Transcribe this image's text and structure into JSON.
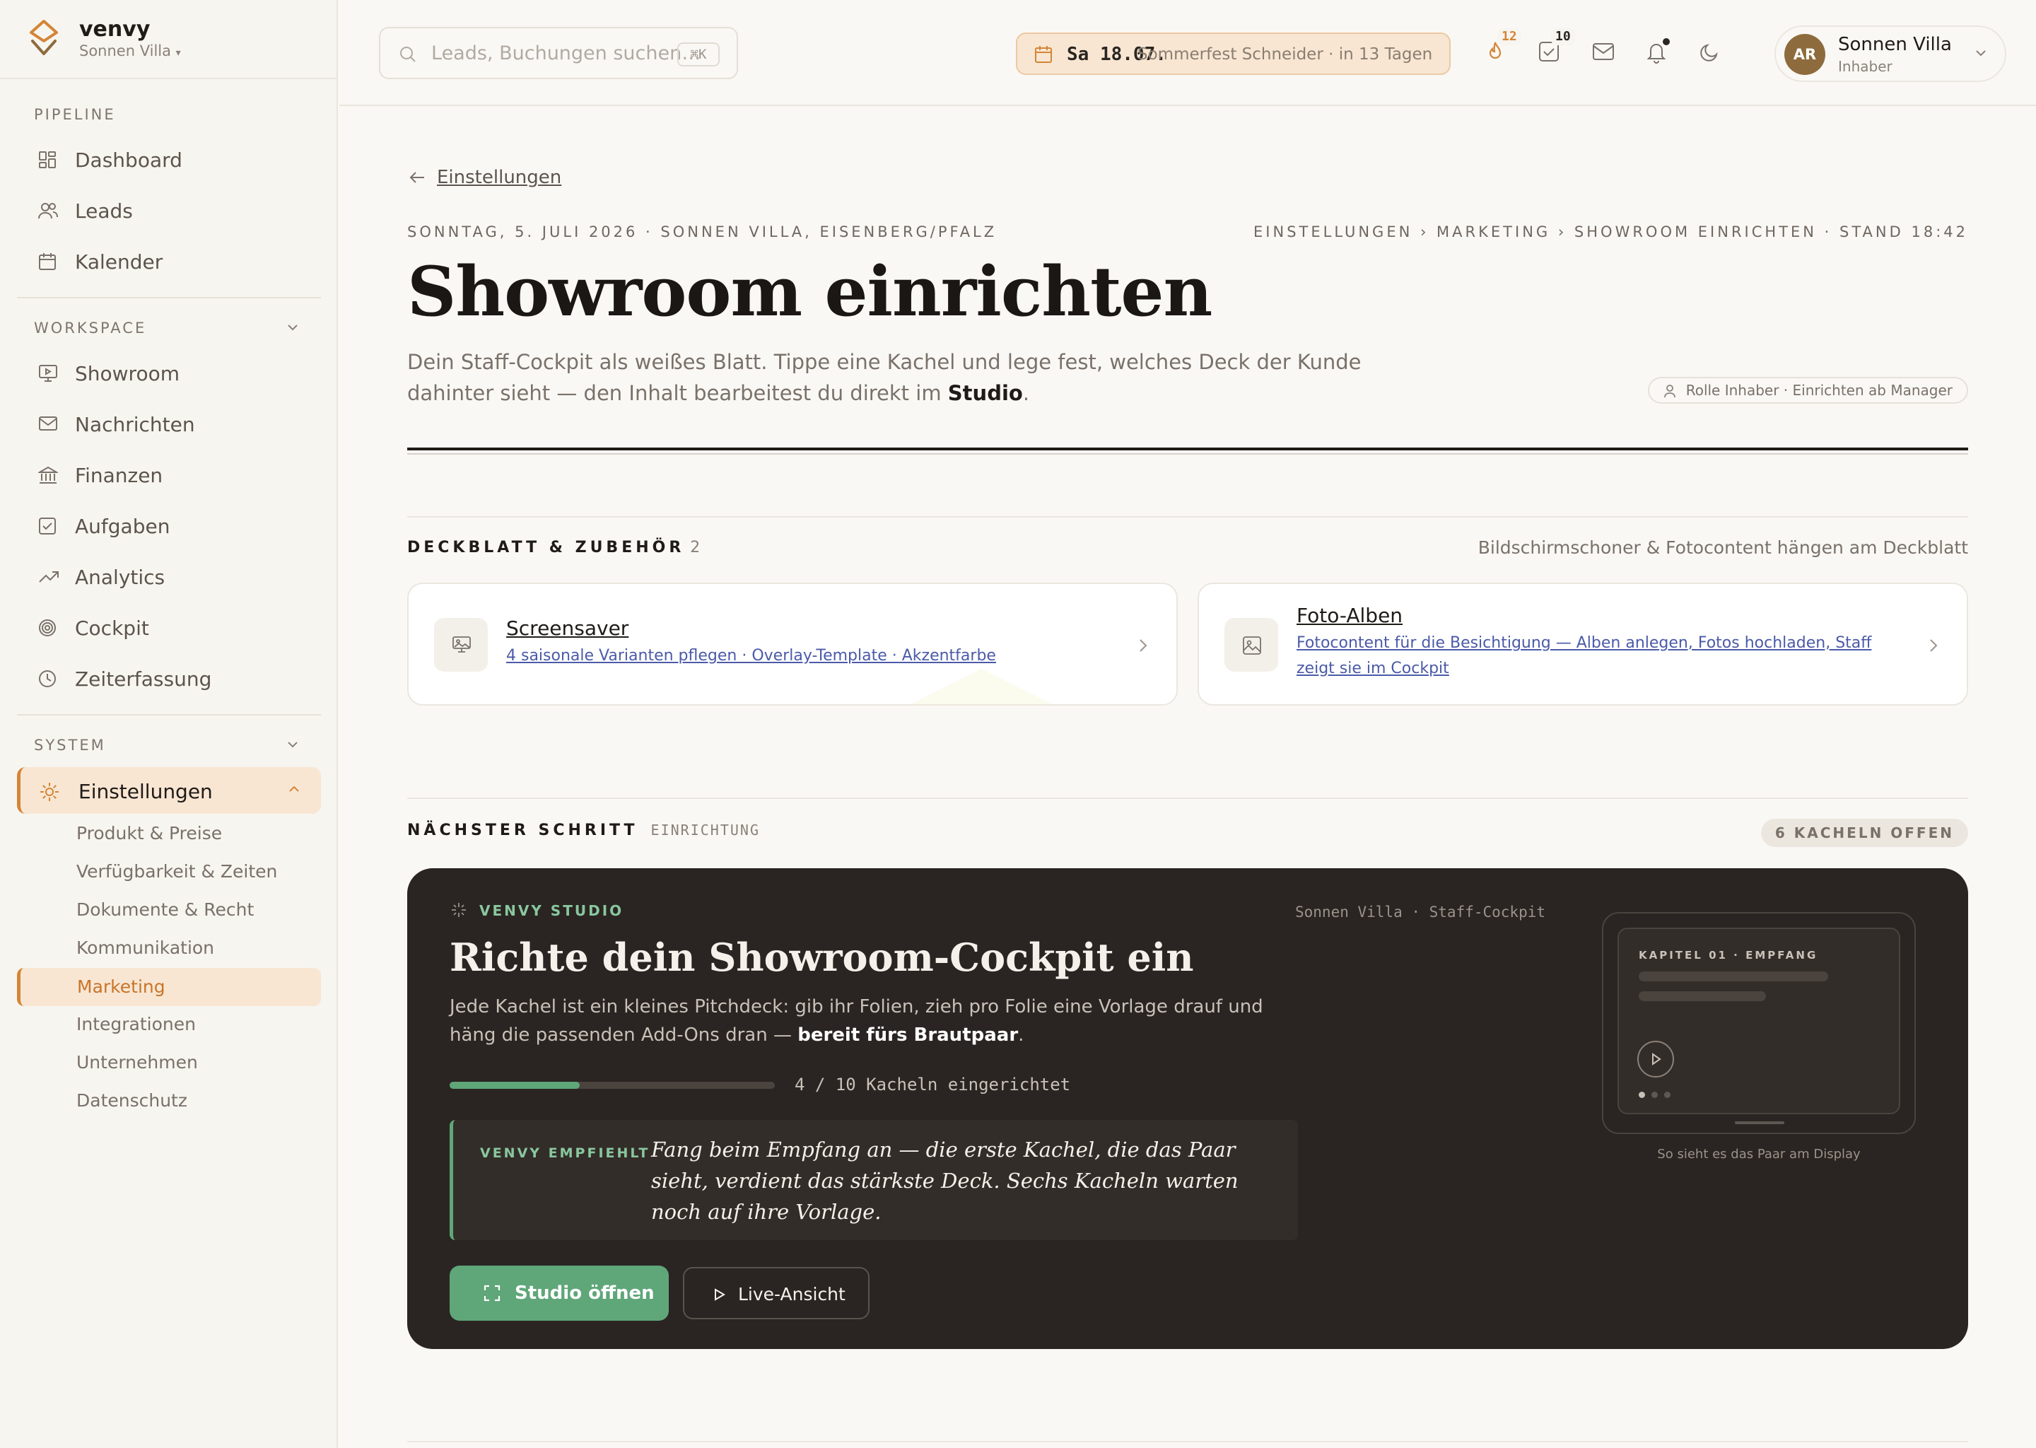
{
  "brand": {
    "name": "venvy",
    "venue": "Sonnen Villa",
    "venue_caret": "▾"
  },
  "sidebar": {
    "pipeline_title": "PIPELINE",
    "pipeline": [
      {
        "label": "Dashboard",
        "icon": "dashboard-icon"
      },
      {
        "label": "Leads",
        "icon": "users-icon"
      },
      {
        "label": "Kalender",
        "icon": "calendar-icon"
      }
    ],
    "workspace_title": "WORKSPACE",
    "workspace": [
      {
        "label": "Showroom",
        "icon": "presentation-icon"
      },
      {
        "label": "Nachrichten",
        "icon": "mail-icon"
      },
      {
        "label": "Finanzen",
        "icon": "bank-icon"
      },
      {
        "label": "Aufgaben",
        "icon": "checkbox-icon"
      },
      {
        "label": "Analytics",
        "icon": "trend-icon"
      },
      {
        "label": "Cockpit",
        "icon": "target-icon"
      },
      {
        "label": "Zeiterfassung",
        "icon": "clock-icon"
      }
    ],
    "system_title": "SYSTEM",
    "settings_label": "Einstellungen",
    "settings_sub": [
      "Produkt & Preise",
      "Verfügbarkeit & Zeiten",
      "Dokumente & Recht",
      "Kommunikation",
      "Marketing",
      "Integrationen",
      "Unternehmen",
      "Datenschutz"
    ]
  },
  "topbar": {
    "search_placeholder": "Leads, Buchungen suchen…",
    "search_kbd": "⌘K",
    "date": "Sa 18.07.",
    "event": "Sommerfest Schneider · in 13 Tagen",
    "leads_badge": "12",
    "tasks_badge": "10",
    "user_initials": "AR",
    "user_name": "Sonnen Villa",
    "user_role": "Inhaber"
  },
  "main": {
    "back_label": "Einstellungen",
    "meta_left": "SONNTAG, 5. JULI 2026 · SONNEN VILLA, EISENBERG/PFALZ",
    "meta_right": "EINSTELLUNGEN › MARKETING › SHOWROOM EINRICHTEN · STAND 18:42",
    "title": "Showroom einrichten",
    "intro_text": "Dein Staff-Cockpit als weißes Blatt. Tippe eine Kachel und lege fest, welches Deck der Kunde dahinter sieht — den Inhalt bearbeitest du direkt im ",
    "intro_bold": "Studio",
    "intro_end": ".",
    "role_pill": "Rolle Inhaber · Einrichten ab Manager",
    "section1_title": "DECKBLATT & ZUBEHÖR",
    "section1_count": "2",
    "section1_hint": "Bildschirmschoner & Fotocontent hängen am Deckblatt",
    "cards": [
      {
        "title": "Screensaver",
        "subtitle": "4 saisonale Varianten pflegen · Overlay-Template · Akzentfarbe"
      },
      {
        "title": "Foto-Alben",
        "subtitle": "Fotocontent für die Besichtigung — Alben anlegen, Fotos hochladen, Staff zeigt sie im Cockpit"
      }
    ],
    "section2_title": "NÄCHSTER SCHRITT",
    "section2_tag": "EINRICHTUNG",
    "section2_pill": "6 KACHELN OFFEN"
  },
  "studio": {
    "eyebrow": "VENVY STUDIO",
    "context": "Sonnen Villa · Staff-Cockpit",
    "title": "Richte dein Showroom-Cockpit ein",
    "text": "Jede Kachel ist ein kleines Pitchdeck: gib ihr Folien, zieh pro Folie eine Vorlage drauf und häng die passenden Add-Ons dran — ",
    "text_bold": "bereit fürs Brautpaar",
    "text_end": ".",
    "progress_done": 4,
    "progress_total": 10,
    "progress_label": "4 / 10 Kacheln eingerichtet",
    "rec_label": "VENVY EMPFIEHLT",
    "rec_quote": "Fang beim Empfang an — die erste Kachel, die das Paar sieht, verdient das stärkste Deck. Sechs Kacheln warten noch auf ihre Vorlage.",
    "primary_button": "Studio öffnen",
    "secondary_button": "Live-Ansicht",
    "preview_chapter": "KAPITEL 01 · EMPFANG",
    "preview_caption": "So sieht es das Paar am Display"
  },
  "colors": {
    "accent": "#d48536",
    "green": "#5fa679",
    "dark": "#2a2522"
  }
}
